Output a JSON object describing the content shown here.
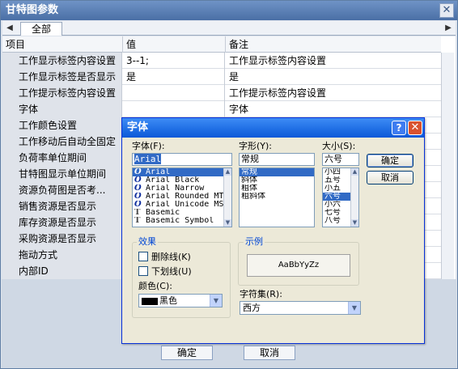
{
  "outer": {
    "title": "甘特图参数",
    "close_glyph": "✕",
    "tab_left_arrow": "◀",
    "tab_right_arrow": "▶",
    "tab_label": "全部",
    "ok_label": "确定",
    "cancel_label": "取消"
  },
  "grid": {
    "headers": [
      "项目",
      "值",
      "备注"
    ],
    "rows": [
      {
        "name": "工作显示标签内容设置",
        "value": "3--1;",
        "note": "工作显示标签内容设置"
      },
      {
        "name": "工作显示标签是否显示",
        "value": "是",
        "note": "是"
      },
      {
        "name": "工作提示标签内容设置",
        "value": "",
        "note": "工作提示标签内容设置"
      },
      {
        "name": "字体",
        "value": "",
        "note": "字体"
      },
      {
        "name": "工作颜色设置",
        "value": "",
        "note": ""
      },
      {
        "name": "工作移动后自动全固定",
        "value": "",
        "note": ""
      },
      {
        "name": "负荷率单位期间",
        "value": "",
        "note": ""
      },
      {
        "name": "甘特图显示单位期间",
        "value": "",
        "note": ""
      },
      {
        "name": "资源负荷图是否考...",
        "value": "",
        "note": ""
      },
      {
        "name": "销售资源是否显示",
        "value": "",
        "note": ""
      },
      {
        "name": "库存资源是否显示",
        "value": "",
        "note": ""
      },
      {
        "name": "采购资源是否显示",
        "value": "",
        "note": ""
      },
      {
        "name": "拖动方式",
        "value": "",
        "note": ""
      },
      {
        "name": "内部ID",
        "value": "",
        "note": ""
      }
    ]
  },
  "font_dialog": {
    "title": "字体",
    "help_glyph": "?",
    "close_glyph": "✕",
    "font_label": "字体(F):",
    "font_value": "Arial",
    "fonts": [
      {
        "icon": "O",
        "name": "Arial",
        "selected": true
      },
      {
        "icon": "O",
        "name": "Arial Black",
        "selected": false
      },
      {
        "icon": "O",
        "name": "Arial Narrow",
        "selected": false
      },
      {
        "icon": "O",
        "name": "Arial Rounded MT B",
        "selected": false
      },
      {
        "icon": "O",
        "name": "Arial Unicode MS",
        "selected": false
      },
      {
        "icon": "T",
        "name": "Basemic",
        "selected": false
      },
      {
        "icon": "T",
        "name": "Basemic Symbol",
        "selected": false
      }
    ],
    "style_label": "字形(Y):",
    "style_value": "常规",
    "styles": [
      {
        "name": "常规",
        "selected": true
      },
      {
        "name": "斜体",
        "selected": false
      },
      {
        "name": "粗体",
        "selected": false
      },
      {
        "name": "粗斜体",
        "selected": false
      }
    ],
    "size_label": "大小(S):",
    "size_value": "六号",
    "sizes": [
      {
        "name": "小四",
        "selected": false
      },
      {
        "name": "五号",
        "selected": false
      },
      {
        "name": "小五",
        "selected": false
      },
      {
        "name": "六号",
        "selected": true
      },
      {
        "name": "小六",
        "selected": false
      },
      {
        "name": "七号",
        "selected": false
      },
      {
        "name": "八号",
        "selected": false
      }
    ],
    "ok_label": "确定",
    "cancel_label": "取消",
    "effects_label": "效果",
    "strikeout_label": "删除线(K)",
    "underline_label": "下划线(U)",
    "color_label": "颜色(C):",
    "color_value": "黑色",
    "sample_label": "示例",
    "sample_text": "AaBbYyZz",
    "charset_label": "字符集(R):",
    "charset_value": "西方"
  }
}
